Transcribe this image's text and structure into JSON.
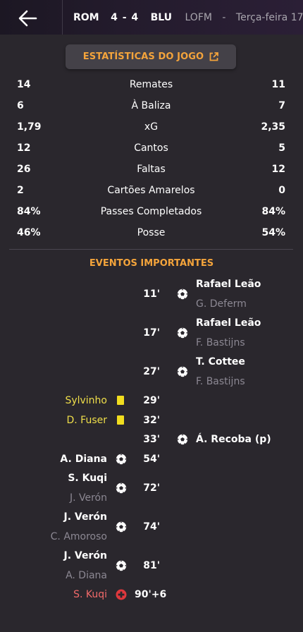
{
  "header": {
    "home": "ROM",
    "score": "4 - 4",
    "away": "BLU",
    "competition": "LOFM",
    "separator": "-",
    "date": "Terça-feira 17"
  },
  "stats_button": {
    "label": "ESTATÍSTICAS DO JOGO"
  },
  "stats": [
    {
      "home": "14",
      "name": "Remates",
      "away": "11"
    },
    {
      "home": "6",
      "name": "À Baliza",
      "away": "7"
    },
    {
      "home": "1,79",
      "name": "xG",
      "away": "2,35"
    },
    {
      "home": "12",
      "name": "Cantos",
      "away": "5"
    },
    {
      "home": "26",
      "name": "Faltas",
      "away": "12"
    },
    {
      "home": "2",
      "name": "Cartões Amarelos",
      "away": "0"
    },
    {
      "home": "84%",
      "name": "Passes Completados",
      "away": "84%"
    },
    {
      "home": "46%",
      "name": "Posse",
      "away": "54%"
    }
  ],
  "events_title": "EVENTOS IMPORTANTES",
  "events": [
    {
      "minute": "11'",
      "side": "away",
      "type": "goal",
      "player": "Rafael Leão",
      "assist": "G. Deferm"
    },
    {
      "minute": "17'",
      "side": "away",
      "type": "goal",
      "player": "Rafael Leão",
      "assist": "F. Bastijns"
    },
    {
      "minute": "27'",
      "side": "away",
      "type": "goal",
      "player": "T. Cottee",
      "assist": "F. Bastijns"
    },
    {
      "minute": "29'",
      "side": "home",
      "type": "yellow",
      "player": "Sylvinho"
    },
    {
      "minute": "32'",
      "side": "home",
      "type": "yellow",
      "player": "D. Fuser"
    },
    {
      "minute": "33'",
      "side": "away",
      "type": "goal",
      "player": "Á. Recoba (p)"
    },
    {
      "minute": "54'",
      "side": "home",
      "type": "goal",
      "player": "A. Diana"
    },
    {
      "minute": "72'",
      "side": "home",
      "type": "goal",
      "player": "S. Kuqi",
      "assist": "J. Verón"
    },
    {
      "minute": "74'",
      "side": "home",
      "type": "goal",
      "player": "J. Verón",
      "assist": "C. Amoroso"
    },
    {
      "minute": "81'",
      "side": "home",
      "type": "goal",
      "player": "J. Verón",
      "assist": "A. Diana"
    },
    {
      "minute": "90'+6",
      "side": "home",
      "type": "injury",
      "player": "S. Kuqi"
    }
  ],
  "colors": {
    "accent": "#f4a43b",
    "background": "#2a272d",
    "yellow_card": "#f1dd1f",
    "injury": "#e0383d",
    "muted_text": "#8c8893"
  }
}
